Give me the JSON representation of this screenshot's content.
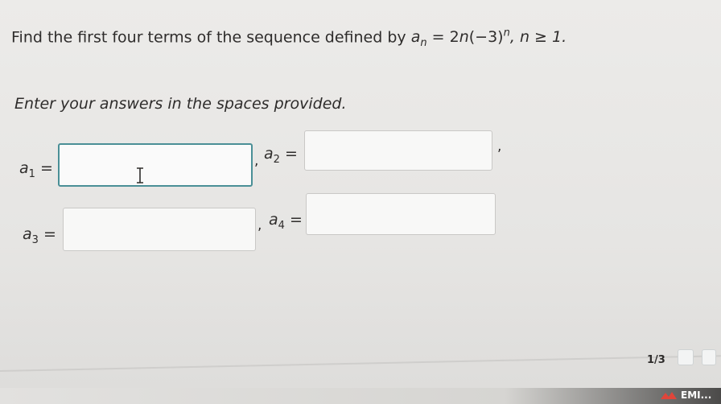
{
  "question": {
    "prefix": "Find the first four terms of the sequence defined by",
    "var": "a",
    "sub": "n",
    "rhs_base": "= 2",
    "rhs_n": "n",
    "rhs_mid": "(−3)",
    "rhs_exp": "n",
    "rhs_tail": ", n ≥ 1."
  },
  "instruction": "Enter your answers in the spaces provided.",
  "answers": [
    {
      "var": "a",
      "sub": "1",
      "eq": "=",
      "value": ""
    },
    {
      "var": "a",
      "sub": "2",
      "eq": "=",
      "value": ""
    },
    {
      "var": "a",
      "sub": "3",
      "eq": "=",
      "value": ""
    },
    {
      "var": "a",
      "sub": "4",
      "eq": "=",
      "value": ""
    }
  ],
  "separators": [
    ",",
    ","
  ],
  "pager": {
    "label": "1/3"
  },
  "taskbar": {
    "label": "EMI..."
  },
  "colors": {
    "active_border": "#4a8f96",
    "text": "#2e2c2b"
  }
}
